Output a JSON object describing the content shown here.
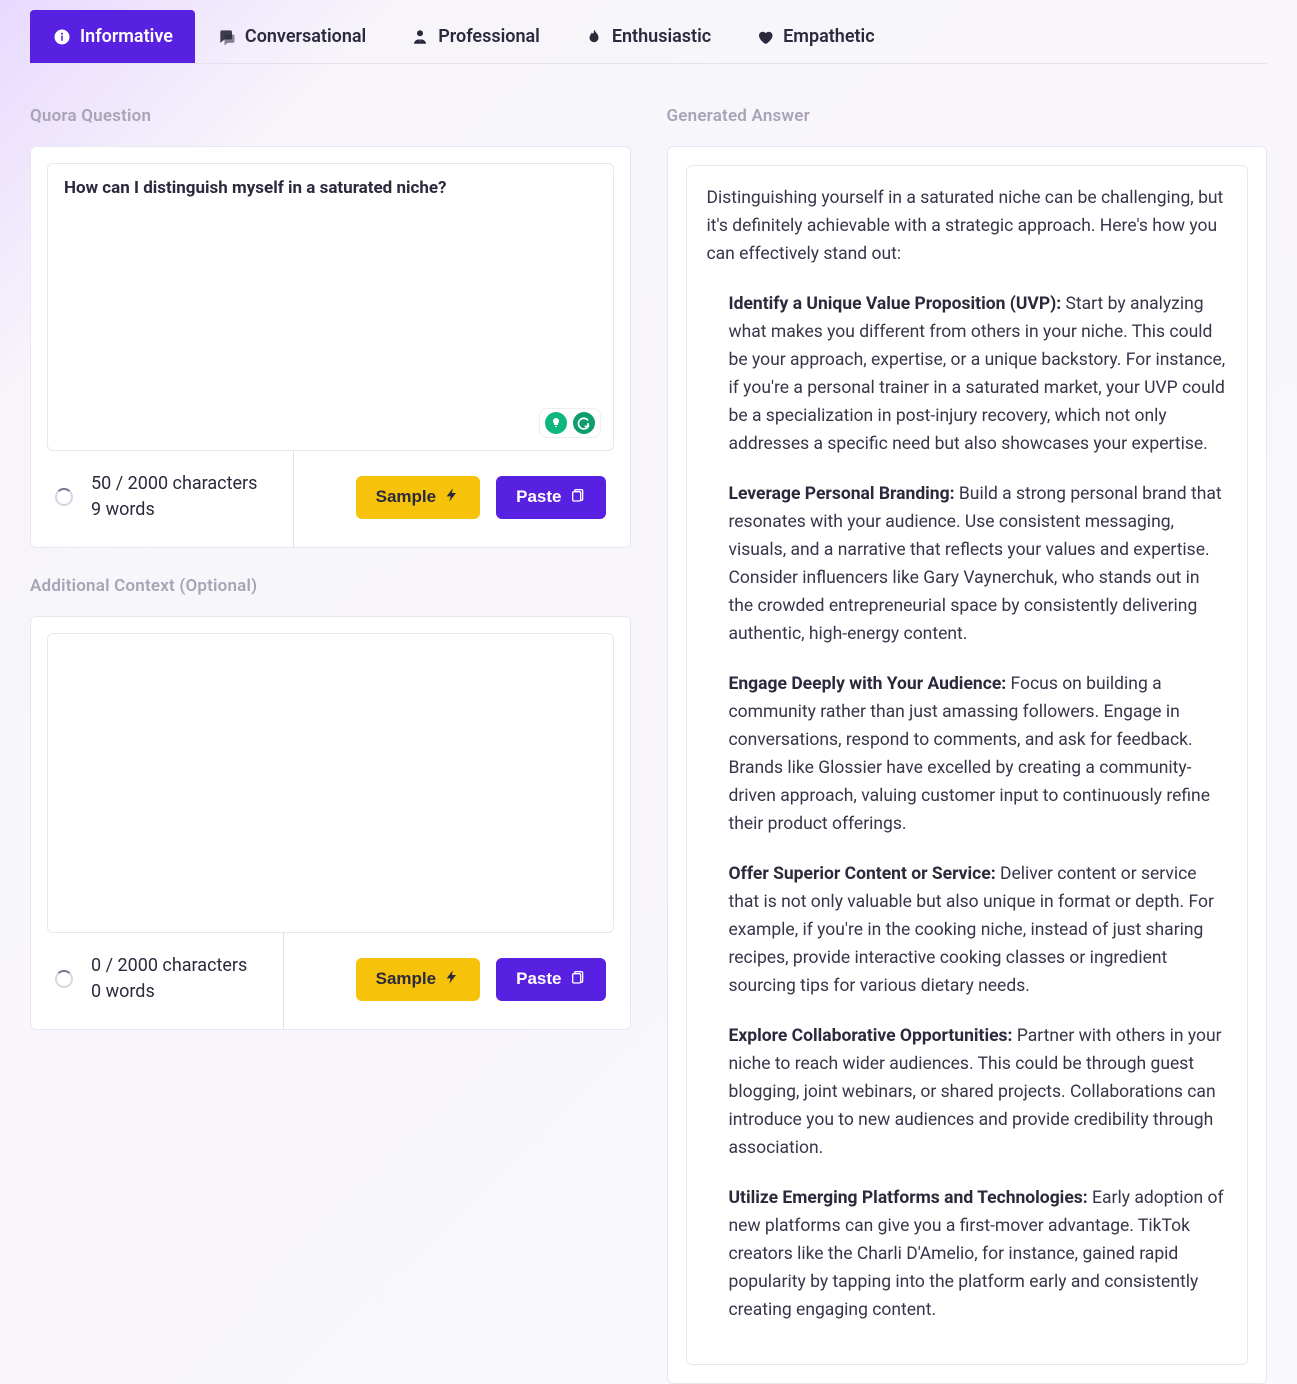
{
  "tabs": {
    "informative": "Informative",
    "conversational": "Conversational",
    "professional": "Professional",
    "enthusiastic": "Enthusiastic",
    "empathetic": "Empathetic"
  },
  "left": {
    "question_label": "Quora Question",
    "question_value": "How can I distinguish myself in a saturated niche?",
    "question_chars": "50 / 2000 characters",
    "question_words": "9 words",
    "context_label": "Additional Context (Optional)",
    "context_chars": "0 / 2000 characters",
    "context_words": "0 words",
    "sample_btn": "Sample",
    "paste_btn": "Paste"
  },
  "right": {
    "label": "Generated Answer",
    "intro": "Distinguishing yourself in a saturated niche can be challenging, but it's definitely achievable with a strategic approach. Here's how you can effectively stand out:",
    "items": [
      {
        "lead": "Identify a Unique Value Proposition (UVP):",
        "body": " Start by analyzing what makes you different from others in your niche. This could be your approach, expertise, or a unique backstory. For instance, if you're a personal trainer in a saturated market, your UVP could be a specialization in post-injury recovery, which not only addresses a specific need but also showcases your expertise."
      },
      {
        "lead": "Leverage Personal Branding:",
        "body": " Build a strong personal brand that resonates with your audience. Use consistent messaging, visuals, and a narrative that reflects your values and expertise. Consider influencers like Gary Vaynerchuk, who stands out in the crowded entrepreneurial space by consistently delivering authentic, high-energy content."
      },
      {
        "lead": "Engage Deeply with Your Audience:",
        "body": " Focus on building a community rather than just amassing followers. Engage in conversations, respond to comments, and ask for feedback. Brands like Glossier have excelled by creating a community-driven approach, valuing customer input to continuously refine their product offerings."
      },
      {
        "lead": "Offer Superior Content or Service:",
        "body": " Deliver content or service that is not only valuable but also unique in format or depth. For example, if you're in the cooking niche, instead of just sharing recipes, provide interactive cooking classes or ingredient sourcing tips for various dietary needs."
      },
      {
        "lead": "Explore Collaborative Opportunities:",
        "body": " Partner with others in your niche to reach wider audiences. This could be through guest blogging, joint webinars, or shared projects. Collaborations can introduce you to new audiences and provide credibility through association."
      },
      {
        "lead": "Utilize Emerging Platforms and Technologies:",
        "body": " Early adoption of new platforms can give you a first-mover advantage. TikTok creators like the Charli D'Amelio, for instance, gained rapid popularity by tapping into the platform early and consistently creating engaging content."
      }
    ]
  }
}
